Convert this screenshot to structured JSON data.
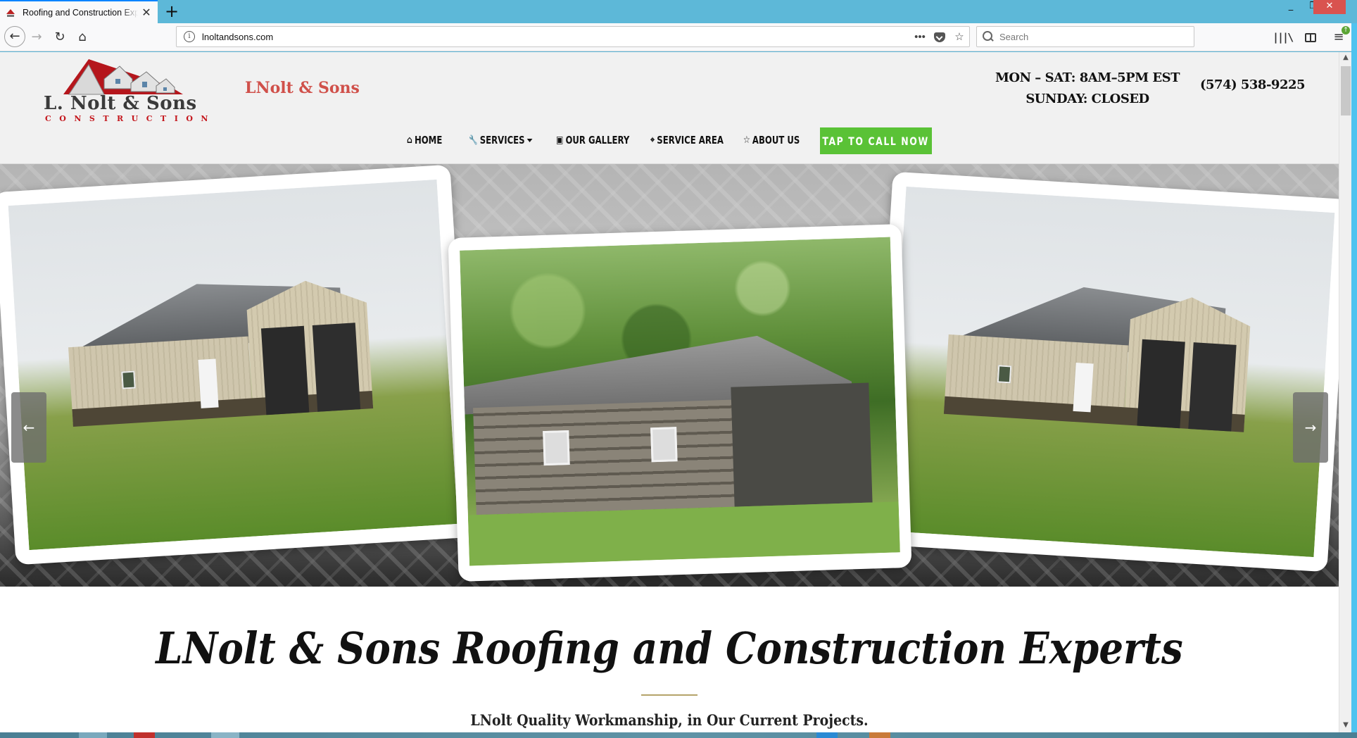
{
  "browser": {
    "tab_title": "Roofing and Construction Experts",
    "new_tab_label": "+",
    "tab_close": "✕",
    "url": "lnoltandsons.com",
    "search_placeholder": "Search",
    "page_actions_label": "•••",
    "window_controls": {
      "minimize": "_",
      "maximize": "❐",
      "close": "✕"
    },
    "nav_icons": {
      "back": "←",
      "forward": "→",
      "reload": "↻",
      "home": "⌂",
      "bookmark": "☆",
      "library": "|||\\",
      "menu": "≡",
      "update_badge": "↑"
    },
    "colors": {
      "tabstrip": "#5DB8D8",
      "close_button": "#D9534F"
    }
  },
  "header": {
    "logo": {
      "name": "L. Nolt & Sons",
      "tagline": "CONSTRUCTION"
    },
    "brand": "LNolt & Sons",
    "hours": [
      "MON – SAT: 8AM–5PM EST",
      "SUNDAY: CLOSED"
    ],
    "phone": "(574) 538-9225"
  },
  "nav": {
    "items": [
      {
        "label": "Home",
        "icon": "⌂"
      },
      {
        "label": "Services",
        "icon": "🔧",
        "dropdown": true
      },
      {
        "label": "Our Gallery",
        "icon": "📷"
      },
      {
        "label": "Service Area",
        "icon": "⚲"
      },
      {
        "label": "About Us",
        "icon": "☆"
      }
    ],
    "cta": "TAP TO CALL NOW",
    "colors": {
      "cta": "#5AC236",
      "brand": "#D0504A"
    }
  },
  "slider": {
    "prev_label": "←",
    "next_label": "→",
    "slides": [
      {
        "alt": "Pole barn garage with two dark doors"
      },
      {
        "alt": "Log cabin with metal roof"
      },
      {
        "alt": "Pole barn garage with two dark doors"
      }
    ]
  },
  "intro": {
    "title_strong": "LNolt & Sons",
    "title_rest": " Roofing and Construction Experts",
    "subtitle": "LNolt Quality Workmanship, in Our Current Projects."
  }
}
